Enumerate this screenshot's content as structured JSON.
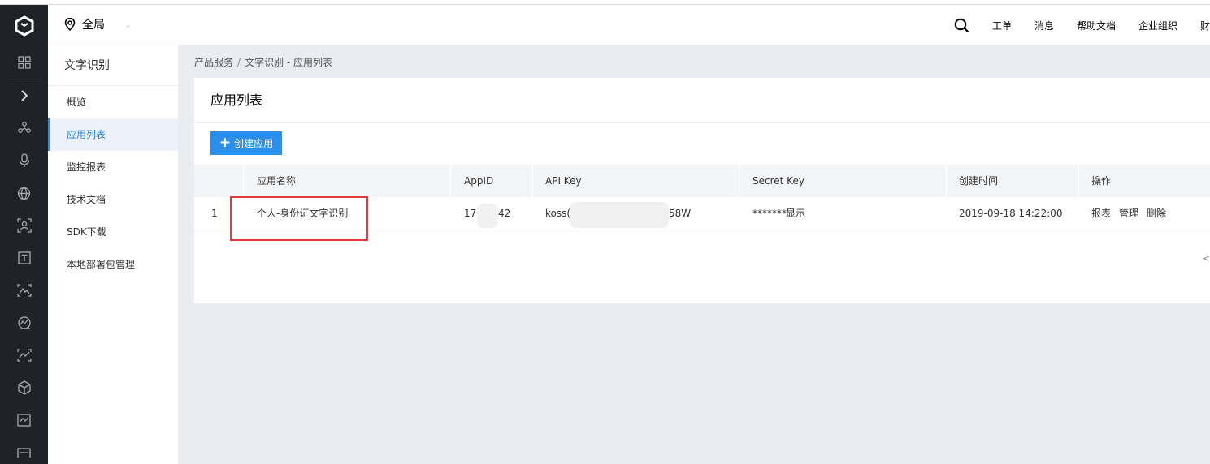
{
  "header": {
    "region": "全局",
    "links": [
      "工单",
      "消息",
      "帮助文档",
      "企业组织",
      "财"
    ]
  },
  "rail": {
    "icons": [
      "dashboard-icon",
      "chevron-right-icon",
      "nodes-icon",
      "microphone-icon",
      "globe-icon",
      "face-scan-icon",
      "text-icon",
      "image-icon",
      "chart-icon",
      "vision-icon",
      "cube-icon",
      "monitor-icon",
      "more-icon"
    ]
  },
  "subnav": {
    "title": "文字识别",
    "items": [
      "概览",
      "应用列表",
      "监控报表",
      "技术文档",
      "SDK下载",
      "本地部署包管理"
    ],
    "active_index": 1
  },
  "breadcrumb": {
    "root": "产品服务",
    "separator": "/",
    "current": "文字识别 - 应用列表"
  },
  "panel": {
    "title": "应用列表",
    "create_button": "创建应用"
  },
  "table": {
    "columns": [
      "应用名称",
      "AppID",
      "API Key",
      "Secret Key",
      "创建时间",
      "操作"
    ],
    "rows": [
      {
        "index": "1",
        "name": "个人-身份证文字识别",
        "appid_prefix": "17",
        "appid_suffix": "42",
        "apikey_prefix": "koss(",
        "apikey_suffix": "58W",
        "secret_mask": "*******",
        "secret_show": "显示",
        "created": "2019-09-18 14:22:00",
        "actions": {
          "report": "报表",
          "manage": "管理",
          "delete": "删除"
        }
      }
    ]
  },
  "pager": {
    "prev": "<"
  },
  "colors": {
    "accent": "#2b8ee8",
    "danger": "#e02020",
    "rail_bg": "#1f2227",
    "highlight": "#e23b3b"
  }
}
